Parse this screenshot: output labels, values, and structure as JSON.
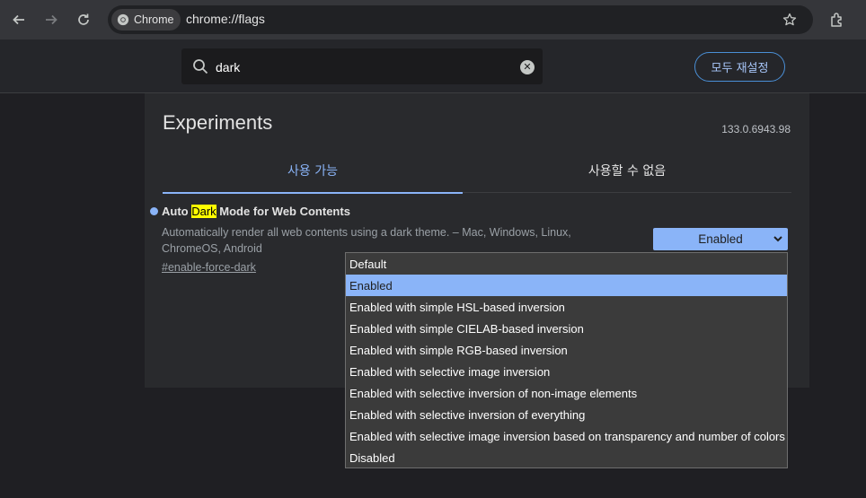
{
  "browser": {
    "chip_label": "Chrome",
    "url": "chrome://flags"
  },
  "flags_page": {
    "search_value": "dark",
    "reset_all_label": "모두 재설정",
    "title": "Experiments",
    "version": "133.0.6943.98",
    "tabs": [
      {
        "label": "사용 가능",
        "active": true
      },
      {
        "label": "사용할 수 없음",
        "active": false
      }
    ]
  },
  "flag": {
    "name_before": "Auto ",
    "name_highlight": "Dark",
    "name_after": " Mode for Web Contents",
    "description": "Automatically render all web contents using a dark theme. – Mac, Windows, Linux, ChromeOS, Android",
    "link": "#enable-force-dark",
    "selected_value": "Enabled"
  },
  "dropdown": {
    "options": [
      "Default",
      "Enabled",
      "Enabled with simple HSL-based inversion",
      "Enabled with simple CIELAB-based inversion",
      "Enabled with simple RGB-based inversion",
      "Enabled with selective image inversion",
      "Enabled with selective inversion of non-image elements",
      "Enabled with selective inversion of everything",
      "Enabled with selective image inversion based on transparency and number of colors",
      "Disabled"
    ],
    "selected_index": 1
  },
  "icons": {
    "back": "arrow-left-icon",
    "forward": "arrow-right-icon",
    "reload": "reload-icon",
    "chrome": "chrome-logo-icon",
    "bookmark": "star-icon",
    "extensions": "puzzle-icon",
    "search": "search-icon",
    "clear": "clear-icon"
  },
  "colors": {
    "accent": "#8ab4f8",
    "highlight": "#ffff00",
    "page_bg": "#1f1f23",
    "panel_bg": "#292a2d"
  }
}
